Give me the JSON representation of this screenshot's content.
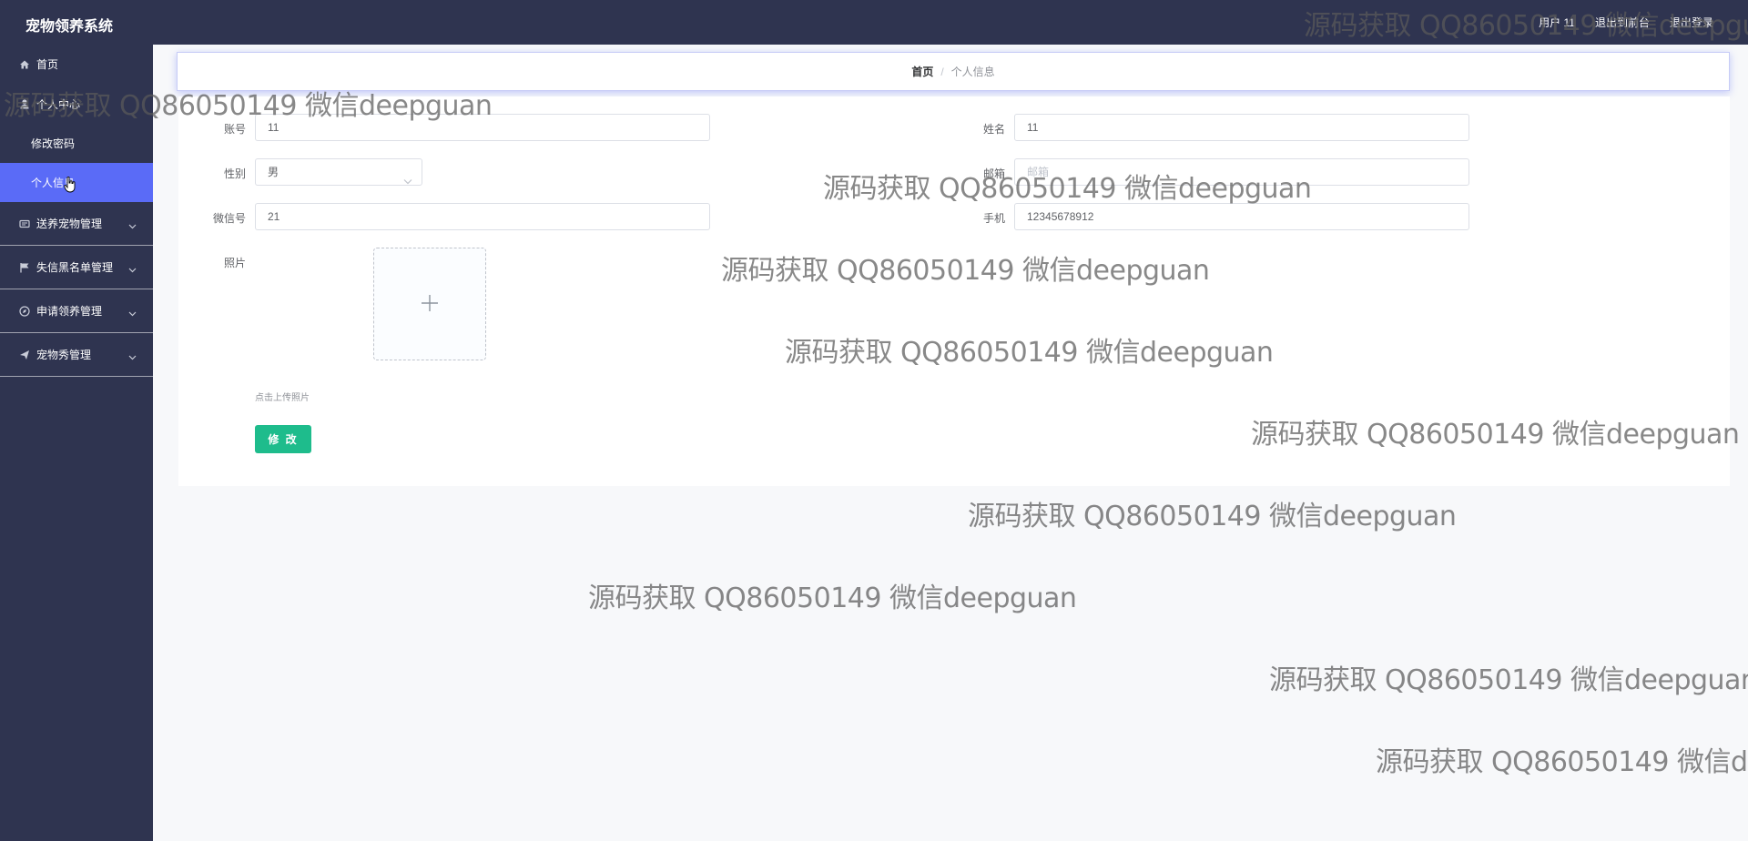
{
  "header": {
    "app_title": "宠物领养系统",
    "user_label": "用户 11",
    "front_link": "退出到前台",
    "logout_link": "退出登录"
  },
  "sidebar": {
    "home": "首页",
    "personal_center": "个人中心",
    "change_password": "修改密码",
    "personal_info": "个人信息",
    "items": [
      {
        "label": "送养宠物管理",
        "icon": "card-icon"
      },
      {
        "label": "失信黑名单管理",
        "icon": "flag-icon"
      },
      {
        "label": "申请领养管理",
        "icon": "compass-icon"
      },
      {
        "label": "宠物秀管理",
        "icon": "send-icon"
      }
    ]
  },
  "breadcrumb": {
    "home": "首页",
    "separator": "/",
    "current": "个人信息"
  },
  "form": {
    "account_label": "账号",
    "account_value": "11",
    "name_label": "姓名",
    "name_value": "11",
    "gender_label": "性别",
    "gender_value": "男",
    "email_label": "邮箱",
    "email_placeholder": "邮箱",
    "wechat_label": "微信号",
    "wechat_value": "21",
    "phone_label": "手机",
    "phone_value": "12345678912",
    "photo_label": "照片",
    "upload_tip": "点击上传照片",
    "submit_label": "修 改"
  },
  "watermark": "源码获取 QQ86050149 微信deepguan",
  "colors": {
    "sidebar_bg": "#2f3450",
    "active_item": "#5a6bf7",
    "submit_button": "#1ebc8c",
    "page_bg": "#f7f8fa"
  }
}
